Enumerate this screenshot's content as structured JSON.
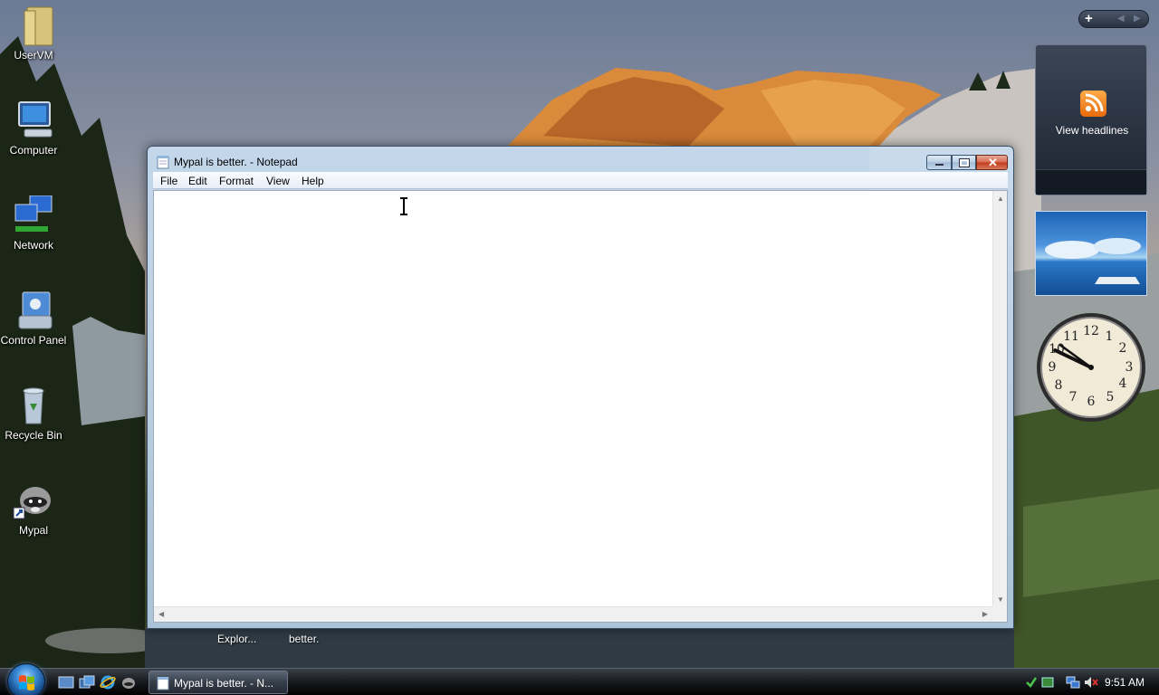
{
  "desktop": {
    "icons": [
      {
        "label": "UserVM",
        "icon": "folder-icon"
      },
      {
        "label": "Computer",
        "icon": "computer-icon"
      },
      {
        "label": "Network",
        "icon": "network-icon"
      },
      {
        "label": "Control Panel",
        "icon": "control-panel-icon"
      },
      {
        "label": "Recycle Bin",
        "icon": "recycle-bin-icon"
      },
      {
        "label": "Mypal",
        "icon": "mypal-icon"
      }
    ],
    "peek_labels": [
      "Explor...",
      "better."
    ]
  },
  "window": {
    "title": "Mypal is better. - Notepad",
    "menu": [
      "File",
      "Edit",
      "Format",
      "View",
      "Help"
    ],
    "content": ""
  },
  "sidebar": {
    "feed_label": "View headlines"
  },
  "taskbar": {
    "task_label": "Mypal is better. - N...",
    "time": "9:51 AM"
  },
  "clock": {
    "hour": 9,
    "minute": 51
  },
  "colors": {
    "feed_orange": "#f07a18",
    "close_red": "#c2391c",
    "taskbar": "#1a1d22"
  }
}
